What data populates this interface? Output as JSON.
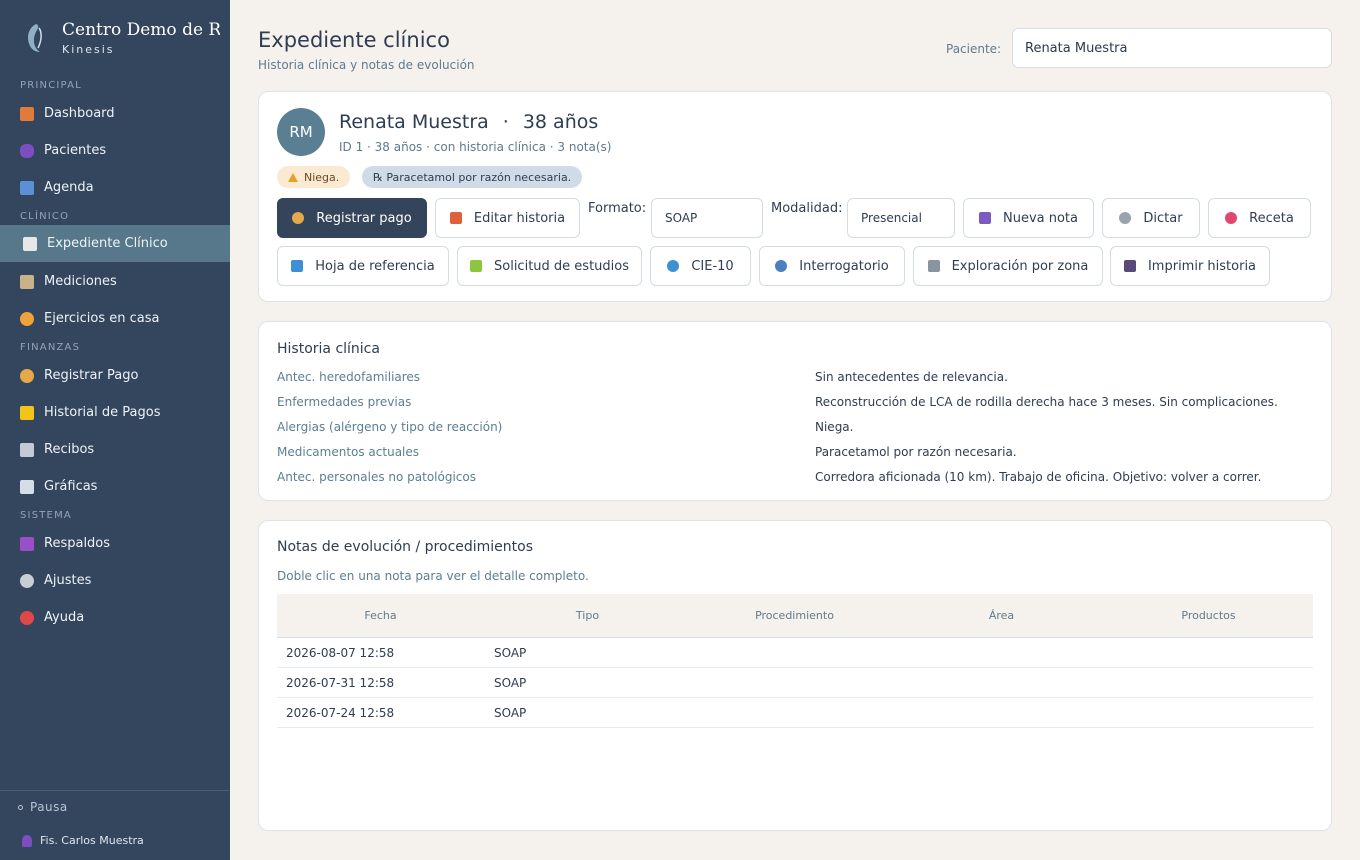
{
  "sidebar": {
    "brand_title": "Centro Demo de Rehabilitación",
    "brand_sub": "Kinesis",
    "sections": {
      "principal": "PRINCIPAL",
      "clinico": "CLÍNICO",
      "finanzas": "FINANZAS",
      "sistema": "SISTEMA"
    },
    "items": [
      {
        "label": "Dashboard",
        "icon": "house-icon",
        "color": "#e07b39"
      },
      {
        "label": "Pacientes",
        "icon": "users-icon",
        "color": "#7b4fc0"
      },
      {
        "label": "Agenda",
        "icon": "calendar-icon",
        "color": "#5b8fd6"
      },
      {
        "label": "Expediente Clínico",
        "icon": "clipboard-icon",
        "color": "#e8e8e8"
      },
      {
        "label": "Mediciones",
        "icon": "ruler-icon",
        "color": "#c9b28a"
      },
      {
        "label": "Ejercicios en casa",
        "icon": "runner-icon",
        "color": "#f0a23a"
      },
      {
        "label": "Registrar Pago",
        "icon": "money-bag-icon",
        "color": "#e5a84a"
      },
      {
        "label": "Historial de Pagos",
        "icon": "ledger-icon",
        "color": "#f2c418"
      },
      {
        "label": "Recibos",
        "icon": "receipt-icon",
        "color": "#c5cbd6"
      },
      {
        "label": "Gráficas",
        "icon": "chart-icon",
        "color": "#d6dde6"
      },
      {
        "label": "Respaldos",
        "icon": "floppy-icon",
        "color": "#9b4fc6"
      },
      {
        "label": "Ajustes",
        "icon": "gear-icon",
        "color": "#c9ced6"
      },
      {
        "label": "Ayuda",
        "icon": "question-icon",
        "color": "#e04848"
      }
    ],
    "status": "Pausa",
    "user": "Fis. Carlos Muestra"
  },
  "header": {
    "title": "Expediente clínico",
    "subtitle": "Historia clínica y notas de evolución",
    "patient_label": "Paciente:",
    "patient_value": "Renata Muestra"
  },
  "patient": {
    "initials": "RM",
    "name": "Renata Muestra",
    "dot": "·",
    "age": "38 años",
    "meta": "ID 1 · 38 años · con historia clínica · 3 nota(s)",
    "allergy_badge": "Niega.",
    "med_badge": "℞ Paracetamol por razón necesaria."
  },
  "toolbar": {
    "register_payment": "Registrar pago",
    "edit_history": "Editar historia",
    "format_label": "Formato:",
    "format_value": "SOAP",
    "modality_label": "Modalidad:",
    "modality_value": "Presencial",
    "new_note": "Nueva nota",
    "dictate": "Dictar",
    "prescription": "Receta",
    "referral": "Hoja de referencia",
    "study_request": "Solicitud de estudios",
    "icd10": "CIE-10",
    "interrogation": "Interrogatorio",
    "zone_exam": "Exploración por zona",
    "print_history": "Imprimir historia"
  },
  "history": {
    "title": "Historia clínica",
    "rows": [
      {
        "label": "Antec. heredofamiliares",
        "value": "Sin antecedentes de relevancia."
      },
      {
        "label": "Enfermedades previas",
        "value": "Reconstrucción de LCA de rodilla derecha hace 3 meses. Sin complicaciones."
      },
      {
        "label": "Alergias (alérgeno y tipo de reacción)",
        "value": "Niega."
      },
      {
        "label": "Medicamentos actuales",
        "value": "Paracetamol por razón necesaria."
      },
      {
        "label": "Antec. personales no patológicos",
        "value": "Corredora aficionada (10 km). Trabajo de oficina. Objetivo: volver a correr."
      }
    ]
  },
  "notes": {
    "title": "Notas de evolución / procedimientos",
    "hint": "Doble clic en una nota para ver el detalle completo.",
    "columns": [
      "Fecha",
      "Tipo",
      "Procedimiento",
      "Área",
      "Productos"
    ],
    "rows": [
      {
        "fecha": "2026-08-07 12:58",
        "tipo": "SOAP",
        "procedimiento": "",
        "area": "",
        "productos": ""
      },
      {
        "fecha": "2026-07-31 12:58",
        "tipo": "SOAP",
        "procedimiento": "",
        "area": "",
        "productos": ""
      },
      {
        "fecha": "2026-07-24 12:58",
        "tipo": "SOAP",
        "procedimiento": "",
        "area": "",
        "productos": ""
      }
    ]
  }
}
